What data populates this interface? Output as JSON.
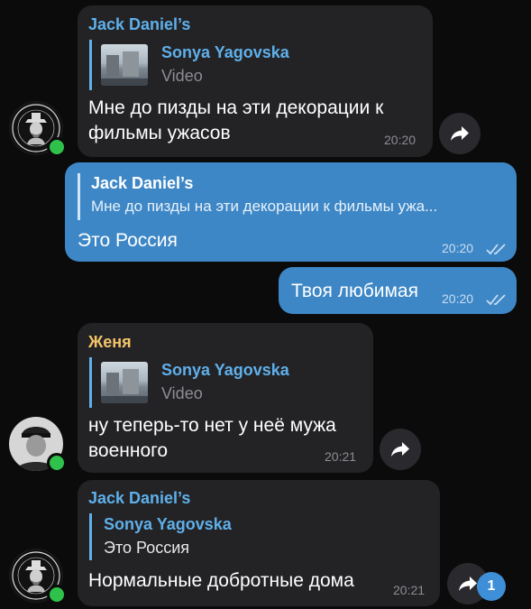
{
  "messages": [
    {
      "sender": "Jack Daniel’s",
      "reply_name": "Sonya Yagovska",
      "reply_sub": "Video",
      "text_line1": "Мне до пизды на эти декорации к",
      "text_line2": "фильмы ужасов",
      "time": "20:20"
    },
    {
      "reply_name": "Jack Daniel’s",
      "reply_sub": "Мне до пизды на эти декорации к фильмы ужа...",
      "text": "Это Россия",
      "time": "20:20"
    },
    {
      "text": "Твоя любимая",
      "time": "20:20"
    },
    {
      "sender": "Женя",
      "reply_name": "Sonya Yagovska",
      "reply_sub": "Video",
      "text_line1": "ну теперь-то нет у неё мужа",
      "text_line2": "военного",
      "time": "20:21"
    },
    {
      "sender": "Jack Daniel’s",
      "reply_name": "Sonya Yagovska",
      "reply_sub": "Это Россия",
      "text": "Нормальные добротные дома",
      "time": "20:21"
    }
  ],
  "badge_count": "1",
  "colors": {
    "background": "#0b0b0c",
    "incoming_bubble": "#232326",
    "outgoing_bubble": "#3e87c6",
    "sender_jack": "#5fb0ea",
    "sender_zhenya": "#f5c46a",
    "online": "#2fc24a"
  },
  "icons": [
    "forward-icon",
    "double-check-icon",
    "online-indicator"
  ]
}
